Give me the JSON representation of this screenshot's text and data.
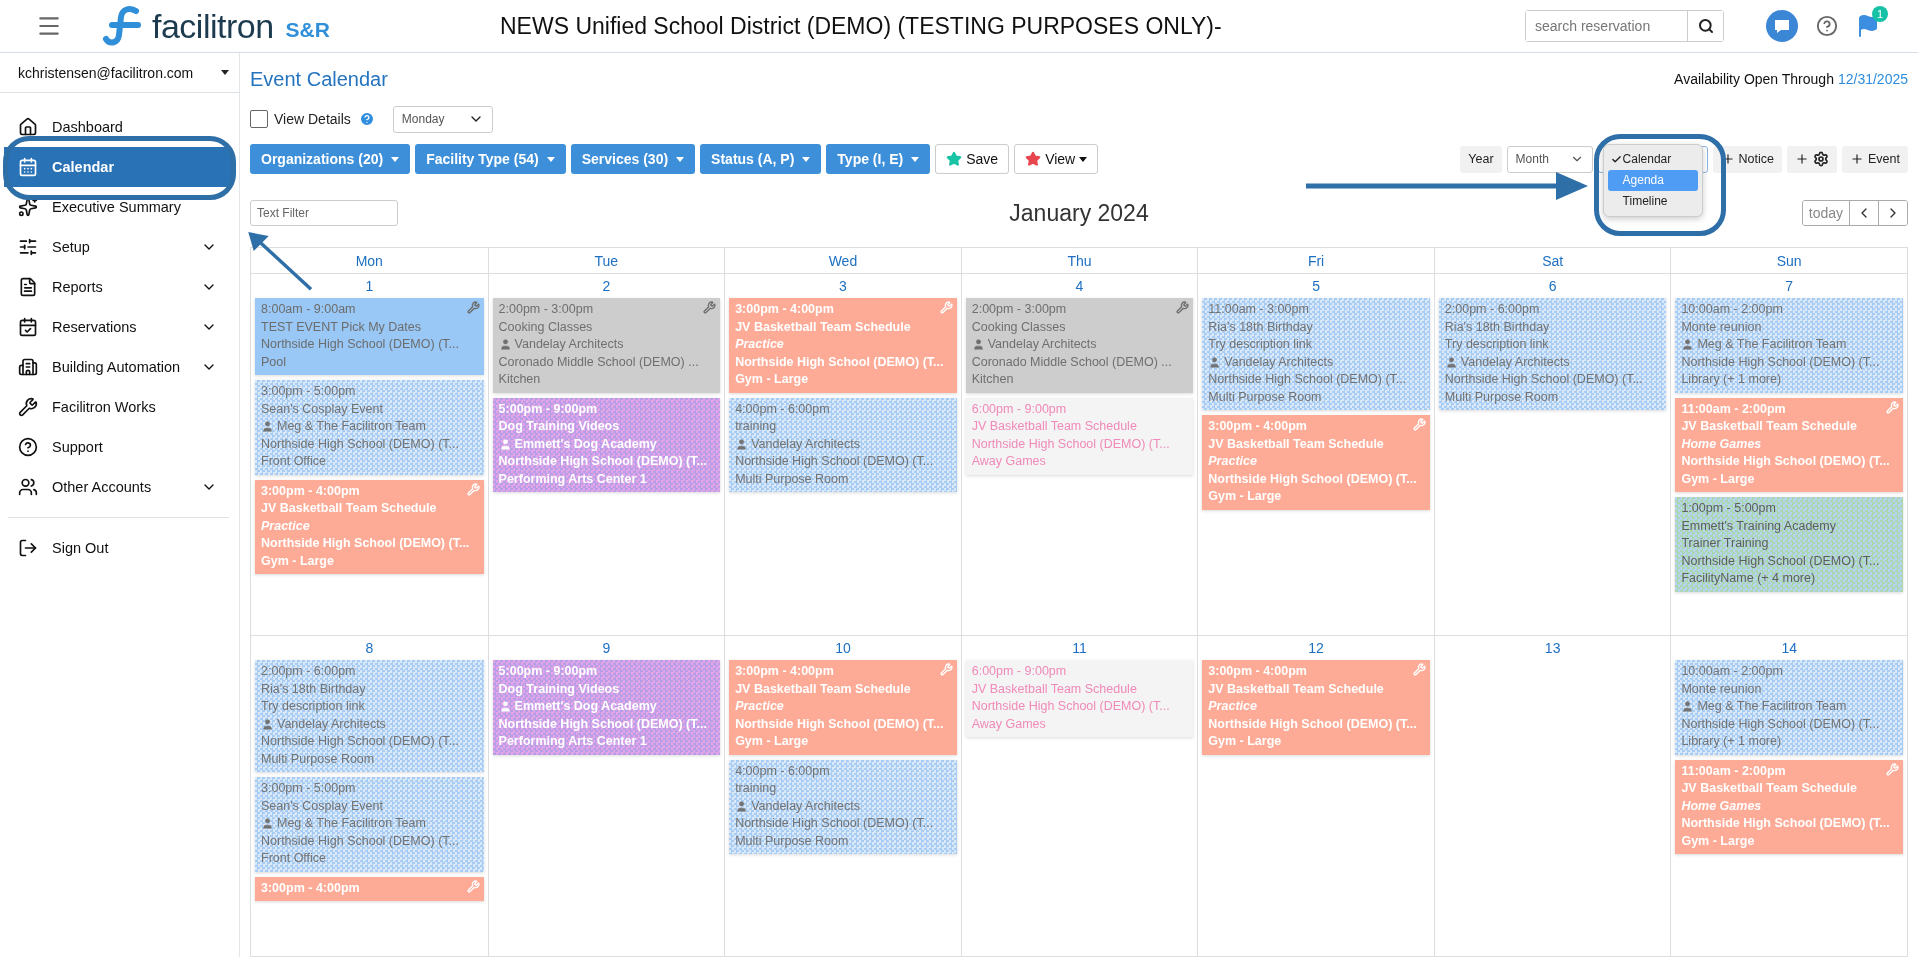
{
  "header": {
    "brand": "facilitron",
    "product": "S&R",
    "title": "NEWS Unified School District (DEMO) (TESTING PURPOSES ONLY)-",
    "search": {
      "placeholder": "search reservation"
    },
    "notification_count": "1"
  },
  "sidebar": {
    "user": "kchristensen@facilitron.com",
    "items": [
      {
        "label": "Dashboard",
        "selected": false,
        "expandable": false
      },
      {
        "label": "Calendar",
        "selected": true,
        "expandable": false
      },
      {
        "label": "Executive Summary",
        "selected": false,
        "expandable": false
      },
      {
        "label": "Setup",
        "selected": false,
        "expandable": true
      },
      {
        "label": "Reports",
        "selected": false,
        "expandable": true
      },
      {
        "label": "Reservations",
        "selected": false,
        "expandable": true
      },
      {
        "label": "Building Automation",
        "selected": false,
        "expandable": true
      },
      {
        "label": "Facilitron Works",
        "selected": false,
        "expandable": false
      },
      {
        "label": "Support",
        "selected": false,
        "expandable": false
      },
      {
        "label": "Other Accounts",
        "selected": false,
        "expandable": true
      }
    ],
    "sign_out": "Sign Out"
  },
  "page": {
    "title": "Event Calendar",
    "availability_label": "Availability Open Through",
    "availability_date": "12/31/2025"
  },
  "options": {
    "view_details": {
      "label": "View Details",
      "checked": false
    },
    "week_start": "Monday"
  },
  "filters": [
    {
      "label": "Organizations (20)"
    },
    {
      "label": "Facility Type (54)"
    },
    {
      "label": "Services (30)"
    },
    {
      "label": "Status (A, P)"
    },
    {
      "label": "Type (I, E)"
    }
  ],
  "save_label": "Save",
  "view_label": "View",
  "views": {
    "year": "Year",
    "month": "Month",
    "menu": [
      {
        "label": "Calendar",
        "checked": true,
        "selected": false
      },
      {
        "label": "Agenda",
        "checked": false,
        "selected": true
      },
      {
        "label": "Timeline",
        "checked": false,
        "selected": false
      }
    ]
  },
  "add_buttons": [
    {
      "kind": "text",
      "label": "Notice"
    },
    {
      "kind": "icon"
    },
    {
      "kind": "text",
      "label": "Event"
    }
  ],
  "text_filter": {
    "placeholder": "Text Filter"
  },
  "month_title": "January 2024",
  "today": "today",
  "calendar": {
    "weekdays": [
      "Mon",
      "Tue",
      "Wed",
      "Thu",
      "Fri",
      "Sat",
      "Sun"
    ],
    "weeks": [
      {
        "days": [
          {
            "date": "1",
            "events": [
              {
                "kind": "solid",
                "wrench": true,
                "time": "8:00am - 9:00am",
                "lines": [
                  {
                    "kind": "plain",
                    "text": "TEST EVENT Pick My Dates"
                  },
                  {
                    "kind": "plain",
                    "text": "Northside High School (DEMO) (T..."
                  },
                  {
                    "kind": "plain",
                    "text": "Pool"
                  }
                ]
              },
              {
                "kind": "blue-pattern",
                "wrench": false,
                "time": "3:00pm - 5:00pm",
                "lines": [
                  {
                    "kind": "plain",
                    "text": "Sean's Cosplay Event"
                  },
                  {
                    "kind": "person",
                    "text": "Meg & The Facilitron Team"
                  },
                  {
                    "kind": "plain",
                    "text": "Northside High School (DEMO) (T..."
                  },
                  {
                    "kind": "plain",
                    "text": "Front Office"
                  }
                ]
              },
              {
                "kind": "salmon",
                "wrench": true,
                "time": "3:00pm - 4:00pm",
                "lines": [
                  {
                    "kind": "plain",
                    "text": "JV Basketball Team Schedule"
                  },
                  {
                    "kind": "italic",
                    "text": "Practice"
                  },
                  {
                    "kind": "plain",
                    "text": "Northside High School (DEMO) (T..."
                  },
                  {
                    "kind": "plain",
                    "text": "Gym - Large"
                  }
                ]
              }
            ]
          },
          {
            "date": "2",
            "events": [
              {
                "kind": "gray",
                "wrench": true,
                "time": "2:00pm - 3:00pm",
                "lines": [
                  {
                    "kind": "plain",
                    "text": "Cooking Classes"
                  },
                  {
                    "kind": "person",
                    "text": "Vandelay Architects"
                  },
                  {
                    "kind": "plain",
                    "text": "Coronado Middle School (DEMO) ..."
                  },
                  {
                    "kind": "plain",
                    "text": "Kitchen"
                  }
                ]
              },
              {
                "kind": "purple-pattern",
                "wrench": false,
                "time": "5:00pm - 9:00pm",
                "lines": [
                  {
                    "kind": "plain",
                    "text": "Dog Training Videos"
                  },
                  {
                    "kind": "person",
                    "text": "Emmett's Dog Academy"
                  },
                  {
                    "kind": "plain",
                    "text": "Northside High School (DEMO) (T..."
                  },
                  {
                    "kind": "plain",
                    "text": "Performing Arts Center 1"
                  }
                ]
              }
            ]
          },
          {
            "date": "3",
            "events": [
              {
                "kind": "salmon",
                "wrench": true,
                "time": "3:00pm - 4:00pm",
                "lines": [
                  {
                    "kind": "plain",
                    "text": "JV Basketball Team Schedule"
                  },
                  {
                    "kind": "italic",
                    "text": "Practice"
                  },
                  {
                    "kind": "plain",
                    "text": "Northside High School (DEMO) (T..."
                  },
                  {
                    "kind": "plain",
                    "text": "Gym - Large"
                  }
                ]
              },
              {
                "kind": "blue-pattern",
                "wrench": false,
                "time": "4:00pm - 6:00pm",
                "lines": [
                  {
                    "kind": "plain",
                    "text": "training"
                  },
                  {
                    "kind": "person",
                    "text": "Vandelay Architects"
                  },
                  {
                    "kind": "plain",
                    "text": "Northside High School (DEMO) (T..."
                  },
                  {
                    "kind": "plain",
                    "text": "Multi Purpose Room"
                  }
                ]
              }
            ]
          },
          {
            "date": "4",
            "events": [
              {
                "kind": "gray",
                "wrench": true,
                "time": "2:00pm - 3:00pm",
                "lines": [
                  {
                    "kind": "plain",
                    "text": "Cooking Classes"
                  },
                  {
                    "kind": "person",
                    "text": "Vandelay Architects"
                  },
                  {
                    "kind": "plain",
                    "text": "Coronado Middle School (DEMO) ..."
                  },
                  {
                    "kind": "plain",
                    "text": "Kitchen"
                  }
                ]
              },
              {
                "kind": "pale",
                "wrench": false,
                "time": "6:00pm - 9:00pm",
                "lines": [
                  {
                    "kind": "plain",
                    "text": "JV Basketball Team Schedule"
                  },
                  {
                    "kind": "plain",
                    "text": "Northside High School (DEMO) (T..."
                  },
                  {
                    "kind": "plain",
                    "text": "Away Games"
                  }
                ]
              }
            ]
          },
          {
            "date": "5",
            "events": [
              {
                "kind": "blue-pattern",
                "wrench": false,
                "time": "11:00am - 3:00pm",
                "lines": [
                  {
                    "kind": "plain",
                    "text": "Ria's 18th Birthday"
                  },
                  {
                    "kind": "plain",
                    "text": "Try description link"
                  },
                  {
                    "kind": "person",
                    "text": "Vandelay Architects"
                  },
                  {
                    "kind": "plain",
                    "text": "Northside High School (DEMO) (T..."
                  },
                  {
                    "kind": "plain",
                    "text": "Multi Purpose Room"
                  }
                ]
              },
              {
                "kind": "salmon",
                "wrench": true,
                "time": "3:00pm - 4:00pm",
                "lines": [
                  {
                    "kind": "plain",
                    "text": "JV Basketball Team Schedule"
                  },
                  {
                    "kind": "italic",
                    "text": "Practice"
                  },
                  {
                    "kind": "plain",
                    "text": "Northside High School (DEMO) (T..."
                  },
                  {
                    "kind": "plain",
                    "text": "Gym - Large"
                  }
                ]
              }
            ]
          },
          {
            "date": "6",
            "events": [
              {
                "kind": "blue-pattern",
                "wrench": false,
                "time": "2:00pm - 6:00pm",
                "lines": [
                  {
                    "kind": "plain",
                    "text": "Ria's 18th Birthday"
                  },
                  {
                    "kind": "plain",
                    "text": "Try description link"
                  },
                  {
                    "kind": "person",
                    "text": "Vandelay Architects"
                  },
                  {
                    "kind": "plain",
                    "text": "Northside High School (DEMO) (T..."
                  },
                  {
                    "kind": "plain",
                    "text": "Multi Purpose Room"
                  }
                ]
              }
            ]
          },
          {
            "date": "7",
            "events": [
              {
                "kind": "blue-pattern",
                "wrench": false,
                "time": "10:00am - 2:00pm",
                "lines": [
                  {
                    "kind": "plain",
                    "text": "Monte reunion"
                  },
                  {
                    "kind": "person",
                    "text": "Meg & The Facilitron Team"
                  },
                  {
                    "kind": "plain",
                    "text": "Northside High School (DEMO) (T..."
                  },
                  {
                    "kind": "plain",
                    "text": "Library (+ 1 more)"
                  }
                ]
              },
              {
                "kind": "salmon",
                "wrench": true,
                "time": "11:00am - 2:00pm",
                "lines": [
                  {
                    "kind": "plain",
                    "text": "JV Basketball Team Schedule"
                  },
                  {
                    "kind": "italic",
                    "text": "Home Games"
                  },
                  {
                    "kind": "plain",
                    "text": "Northside High School (DEMO) (T..."
                  },
                  {
                    "kind": "plain",
                    "text": "Gym - Large"
                  }
                ]
              },
              {
                "kind": "green-pattern",
                "wrench": false,
                "time": "1:00pm - 5:00pm",
                "lines": [
                  {
                    "kind": "plain",
                    "text": "Emmett's Training Academy"
                  },
                  {
                    "kind": "plain",
                    "text": "Trainer Training"
                  },
                  {
                    "kind": "plain",
                    "text": "Northside High School (DEMO) (T..."
                  },
                  {
                    "kind": "plain",
                    "text": "FacilityName (+ 4 more)"
                  }
                ]
              }
            ]
          }
        ]
      },
      {
        "days": [
          {
            "date": "8",
            "events": [
              {
                "kind": "blue-pattern",
                "wrench": false,
                "time": "2:00pm - 6:00pm",
                "lines": [
                  {
                    "kind": "plain",
                    "text": "Ria's 18th Birthday"
                  },
                  {
                    "kind": "plain",
                    "text": "Try description link"
                  },
                  {
                    "kind": "person",
                    "text": "Vandelay Architects"
                  },
                  {
                    "kind": "plain",
                    "text": "Northside High School (DEMO) (T..."
                  },
                  {
                    "kind": "plain",
                    "text": "Multi Purpose Room"
                  }
                ]
              },
              {
                "kind": "blue-pattern",
                "wrench": false,
                "time": "3:00pm - 5:00pm",
                "lines": [
                  {
                    "kind": "plain",
                    "text": "Sean's Cosplay Event"
                  },
                  {
                    "kind": "person",
                    "text": "Meg & The Facilitron Team"
                  },
                  {
                    "kind": "plain",
                    "text": "Northside High School (DEMO) (T..."
                  },
                  {
                    "kind": "plain",
                    "text": "Front Office"
                  }
                ]
              },
              {
                "kind": "salmon",
                "wrench": true,
                "time": "3:00pm - 4:00pm"
              }
            ]
          },
          {
            "date": "9",
            "events": [
              {
                "kind": "purple-pattern",
                "wrench": false,
                "time": "5:00pm - 9:00pm",
                "lines": [
                  {
                    "kind": "plain",
                    "text": "Dog Training Videos"
                  },
                  {
                    "kind": "person",
                    "text": "Emmett's Dog Academy"
                  },
                  {
                    "kind": "plain",
                    "text": "Northside High School (DEMO) (T..."
                  },
                  {
                    "kind": "plain",
                    "text": "Performing Arts Center 1"
                  }
                ]
              }
            ]
          },
          {
            "date": "10",
            "events": [
              {
                "kind": "salmon",
                "wrench": true,
                "time": "3:00pm - 4:00pm",
                "lines": [
                  {
                    "kind": "plain",
                    "text": "JV Basketball Team Schedule"
                  },
                  {
                    "kind": "italic",
                    "text": "Practice"
                  },
                  {
                    "kind": "plain",
                    "text": "Northside High School (DEMO) (T..."
                  },
                  {
                    "kind": "plain",
                    "text": "Gym - Large"
                  }
                ]
              },
              {
                "kind": "blue-pattern",
                "wrench": false,
                "time": "4:00pm - 6:00pm",
                "lines": [
                  {
                    "kind": "plain",
                    "text": "training"
                  },
                  {
                    "kind": "person",
                    "text": "Vandelay Architects"
                  },
                  {
                    "kind": "plain",
                    "text": "Northside High School (DEMO) (T..."
                  },
                  {
                    "kind": "plain",
                    "text": "Multi Purpose Room"
                  }
                ]
              }
            ]
          },
          {
            "date": "11",
            "events": [
              {
                "kind": "pale",
                "wrench": false,
                "time": "6:00pm - 9:00pm",
                "lines": [
                  {
                    "kind": "plain",
                    "text": "JV Basketball Team Schedule"
                  },
                  {
                    "kind": "plain",
                    "text": "Northside High School (DEMO) (T..."
                  },
                  {
                    "kind": "plain",
                    "text": "Away Games"
                  }
                ]
              }
            ]
          },
          {
            "date": "12",
            "events": [
              {
                "kind": "salmon",
                "wrench": true,
                "time": "3:00pm - 4:00pm",
                "lines": [
                  {
                    "kind": "plain",
                    "text": "JV Basketball Team Schedule"
                  },
                  {
                    "kind": "italic",
                    "text": "Practice"
                  },
                  {
                    "kind": "plain",
                    "text": "Northside High School (DEMO) (T..."
                  },
                  {
                    "kind": "plain",
                    "text": "Gym - Large"
                  }
                ]
              }
            ]
          },
          {
            "date": "13"
          },
          {
            "date": "14",
            "events": [
              {
                "kind": "blue-pattern",
                "wrench": false,
                "time": "10:00am - 2:00pm",
                "lines": [
                  {
                    "kind": "plain",
                    "text": "Monte reunion"
                  },
                  {
                    "kind": "person",
                    "text": "Meg & The Facilitron Team"
                  },
                  {
                    "kind": "plain",
                    "text": "Northside High School (DEMO) (T..."
                  },
                  {
                    "kind": "plain",
                    "text": "Library (+ 1 more)"
                  }
                ]
              },
              {
                "kind": "salmon",
                "wrench": true,
                "time": "11:00am - 2:00pm",
                "lines": [
                  {
                    "kind": "plain",
                    "text": "JV Basketball Team Schedule"
                  },
                  {
                    "kind": "italic",
                    "text": "Home Games"
                  },
                  {
                    "kind": "plain",
                    "text": "Northside High School (DEMO) (T..."
                  },
                  {
                    "kind": "plain",
                    "text": "Gym - Large"
                  }
                ]
              }
            ]
          }
        ]
      }
    ]
  }
}
